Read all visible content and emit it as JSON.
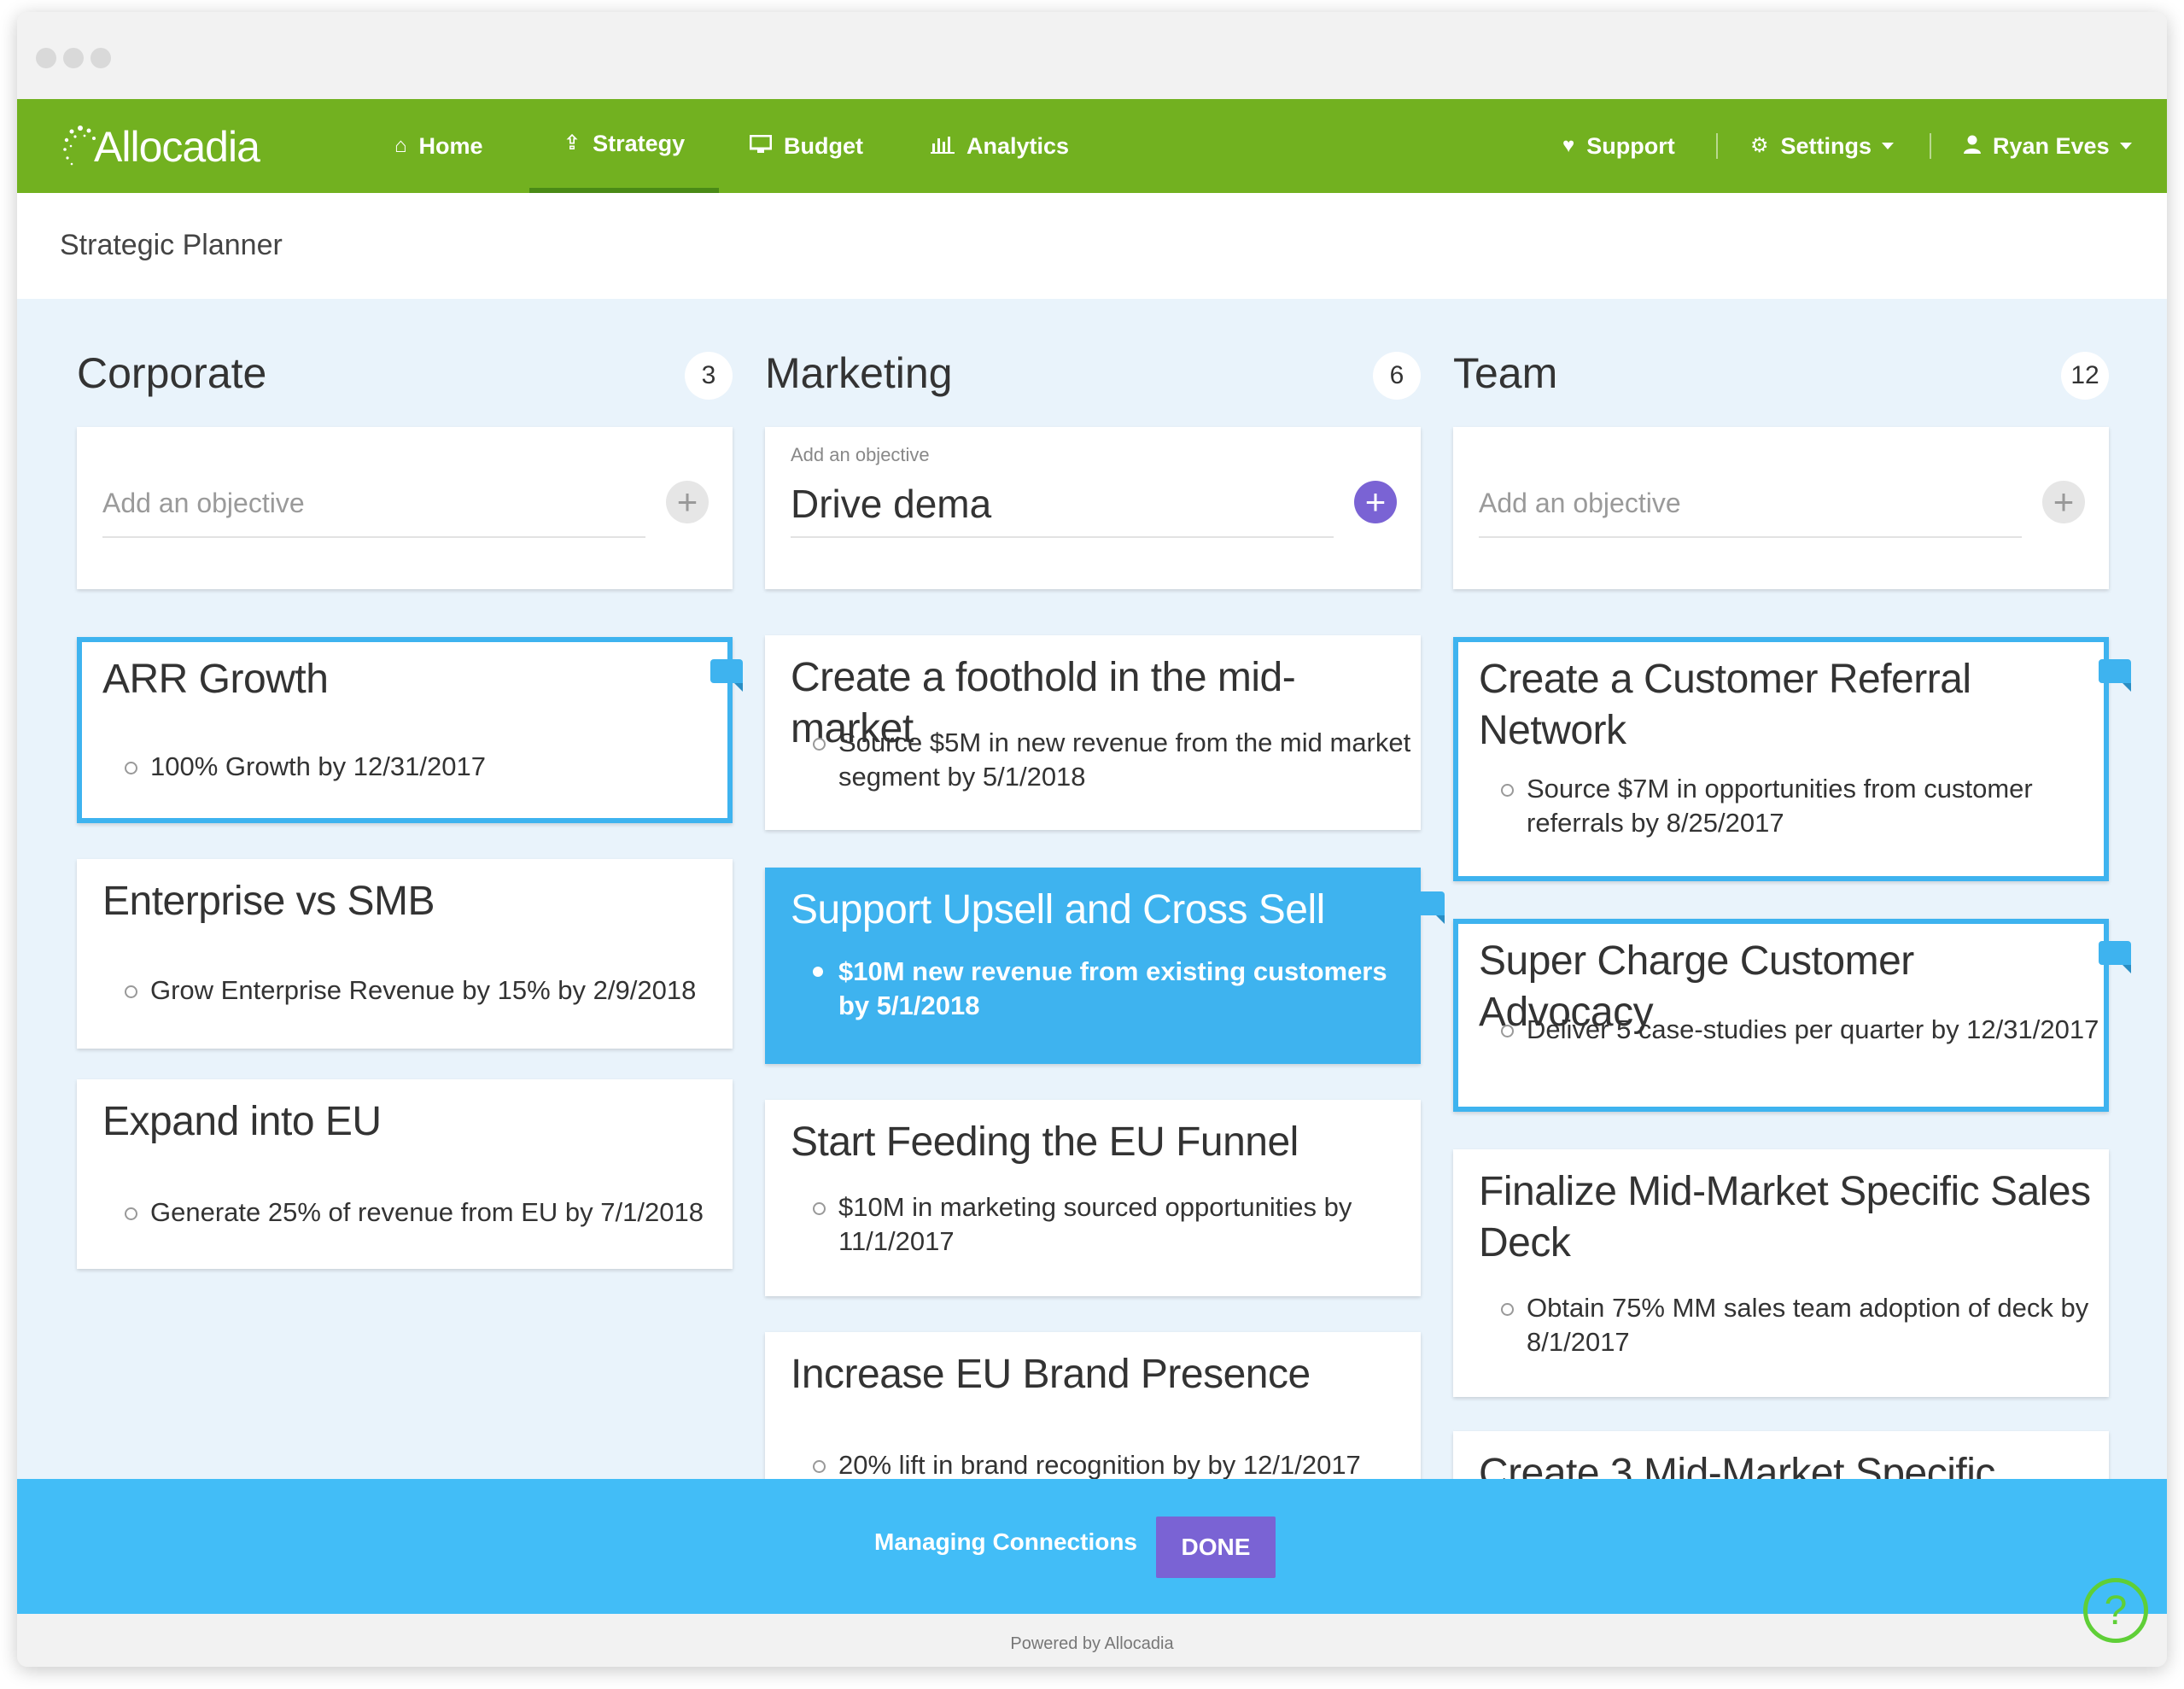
{
  "app": {
    "logo_text": "Allocadia",
    "colors": {
      "nav_green": "#72b120",
      "accent_blue": "#3eb3ef",
      "purple": "#7a63d4",
      "board_bg": "#e9f3fb"
    }
  },
  "nav": {
    "items": [
      {
        "label": "Home",
        "icon": "home-icon"
      },
      {
        "label": "Strategy",
        "icon": "strategy-icon",
        "active": true
      },
      {
        "label": "Budget",
        "icon": "monitor-icon"
      },
      {
        "label": "Analytics",
        "icon": "bar-chart-icon"
      }
    ],
    "right": [
      {
        "label": "Support",
        "icon": "heart-icon"
      },
      {
        "label": "Settings",
        "icon": "gear-icon"
      },
      {
        "label": "Ryan Eves",
        "icon": "user-icon"
      }
    ]
  },
  "page": {
    "title": "Strategic Planner"
  },
  "columns": [
    {
      "title": "Corporate",
      "count": "3",
      "add": {
        "label": "",
        "value": "",
        "placeholder": "Add an objective"
      },
      "cards": [
        {
          "title": "ARR Growth",
          "results": [
            "100% Growth by 12/31/2017"
          ]
        },
        {
          "title": "Enterprise vs SMB",
          "results": [
            "Grow Enterprise Revenue by 15% by 2/9/2018"
          ]
        },
        {
          "title": "Expand into EU",
          "results": [
            "Generate 25% of revenue from EU by 7/1/2018"
          ]
        }
      ]
    },
    {
      "title": "Marketing",
      "count": "6",
      "add": {
        "label": "Add an objective",
        "value": "Drive dema",
        "placeholder": ""
      },
      "cards": [
        {
          "title": "Create a foothold in the mid-market",
          "results": [
            "Source $5M in new revenue from the mid market segment by 5/1/2018"
          ]
        },
        {
          "title": "Support Upsell and Cross Sell",
          "results": [
            "$10M new revenue from existing customers by 5/1/2018"
          ]
        },
        {
          "title": "Start Feeding the EU Funnel",
          "results": [
            "$10M in marketing sourced opportunities by 11/1/2017"
          ]
        },
        {
          "title": "Increase EU Brand Presence",
          "results": [
            "20% lift in brand recognition by by 12/1/2017"
          ]
        }
      ]
    },
    {
      "title": "Team",
      "count": "12",
      "add": {
        "label": "",
        "value": "",
        "placeholder": "Add an objective"
      },
      "cards": [
        {
          "title": "Create a Customer Referral Network",
          "results": [
            "Source $7M in opportunities from customer referrals by 8/25/2017"
          ]
        },
        {
          "title": "Super Charge Customer Advocacy",
          "results": [
            "Deliver 5 case-studies per quarter by 12/31/2017"
          ]
        },
        {
          "title": "Finalize Mid-Market Specific Sales Deck",
          "results": [
            "Obtain 75% MM sales team adoption of deck by 8/1/2017"
          ]
        },
        {
          "title": "Create 3 Mid-Market Specific",
          "results": []
        }
      ]
    }
  ],
  "connections_bar": {
    "text": "Managing Connections",
    "done_label": "DONE"
  },
  "footer": {
    "powered_by": "Powered by Allocadia"
  },
  "help": {
    "label": "?"
  }
}
